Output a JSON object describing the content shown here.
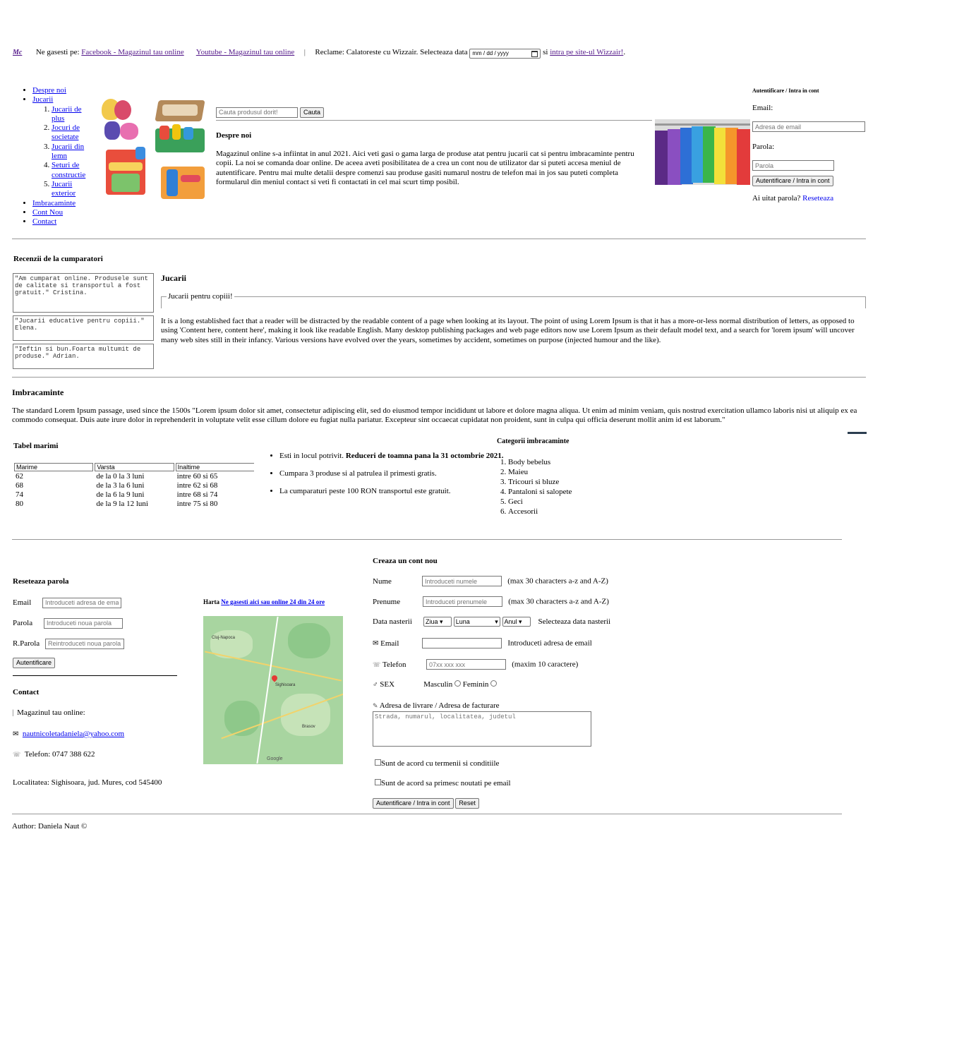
{
  "topbar": {
    "logo": "Mc",
    "find_us": "Ne gasesti pe:",
    "facebook_link": "Facebook - Magazinul tau online",
    "youtube_link": "Youtube - Magazinul tau online",
    "separator": "|",
    "ad_text": "Reclame: Calatoreste cu Wizzair. Selecteaza data",
    "date_placeholder": "mm / dd / yyyy",
    "and_text": "si",
    "wizzair_link": "intra pe site-ul Wizzair!",
    "end": "."
  },
  "nav": {
    "items": [
      "Despre noi",
      "Jucarii",
      "Imbracaminte",
      "Cont Nou",
      "Contact"
    ],
    "subitems": [
      "Jucarii de plus",
      "Jocuri de societate",
      "Jucarii din lemn",
      "Seturi de constructie",
      "Jucarii exterior"
    ]
  },
  "search": {
    "placeholder": "Cauta produsul dorit!",
    "button": "Cauta"
  },
  "about": {
    "title": "Despre noi",
    "text": "Magazinul online s-a infiintat in anul 2021. Aici veti gasi o gama larga de produse atat pentru jucarii cat si pentru imbracaminte pentru copii. La noi se comanda doar online. De aceea aveti posibilitatea de a crea un cont nou de utilizator dar si puteti accesa meniul de autentificare. Pentru mai multe detalii despre comenzi sau produse gasiti numarul nostru de telefon mai in jos sau puteti completa formularul din meniul contact si veti fi contactati in cel mai scurt timp posibil."
  },
  "login": {
    "title": "Autentificare / Intra in cont",
    "email_label": "Email:",
    "email_placeholder": "Adresa de email",
    "password_label": "Parola:",
    "password_placeholder": "Parola",
    "button": "Autentificare / Intra in cont",
    "forgot": "Ai uitat parola?",
    "reset_link": "Reseteaza"
  },
  "reviews": {
    "title": "Recenzii de la cumparatori",
    "items": [
      "\"Am cumparat online. Produsele sunt de calitate si transportul a fost gratuit.\" Cristina.",
      "\"Jucarii educative pentru copiii.\" Elena.",
      "\"Ieftin si bun.Foarta multumit de produse.\" Adrian."
    ]
  },
  "toys": {
    "title": "Jucarii",
    "legend": "Jucarii pentru copiii!",
    "text": "It is a long established fact that a reader will be distracted by the readable content of a page when looking at its layout. The point of using Lorem Ipsum is that it has a more-or-less normal distribution of letters, as opposed to using 'Content here, content here', making it look like readable English. Many desktop publishing packages and web page editors now use Lorem Ipsum as their default model text, and a search for 'lorem ipsum' will uncover many web sites still in their infancy. Various versions have evolved over the years, sometimes by accident, sometimes on purpose (injected humour and the like)."
  },
  "clothes": {
    "title": "Imbracaminte",
    "text": "The standard Lorem Ipsum passage, used since the 1500s \"Lorem ipsum dolor sit amet, consectetur adipiscing elit, sed do eiusmod tempor incididunt ut labore et dolore magna aliqua. Ut enim ad minim veniam, quis nostrud exercitation ullamco laboris nisi ut aliquip ex ea commodo consequat. Duis aute irure dolor in reprehenderit in voluptate velit esse cillum dolore eu fugiat nulla pariatur. Excepteur sint occaecat cupidatat non proident, sunt in culpa qui officia deserunt mollit anim id est laborum.\""
  },
  "size_table": {
    "title": "Tabel marimi",
    "headers": [
      "Marime",
      "Varsta",
      "Inaltime"
    ],
    "rows": [
      [
        "62",
        "de la 0 la 3 luni",
        "intre 60 si 65"
      ],
      [
        "68",
        "de la 3 la 6 luni",
        "intre 62 si 68"
      ],
      [
        "74",
        "de la 6 la 9 luni",
        "intre 68 si 74"
      ],
      [
        "80",
        "de la 9 la 12 luni",
        "intre 75 si 80"
      ]
    ]
  },
  "promo": {
    "item1_prefix": "Esti in locul potrivit.",
    "item1_bold": "Reduceri de toamna pana la 31 octombrie 2021.",
    "item2": "Cumpara 3 produse si al patrulea il primesti gratis.",
    "item3": "La cumparaturi peste 100 RON transportul este gratuit."
  },
  "categories": {
    "title": "Categorii imbracaminte",
    "items": [
      "Body bebelus",
      "Maieu",
      "Tricouri si bluze",
      "Pantaloni si salopete",
      "Geci",
      "Accesorii"
    ]
  },
  "reset": {
    "title": "Reseteaza parola",
    "email_label": "Email",
    "email_placeholder": "Introduceti adresa de email",
    "password_label": "Parola",
    "password_placeholder": "Introduceti noua parola",
    "repeat_label": "R.Parola",
    "repeat_placeholder": "Reintroduceti noua parola",
    "button": "Autentificare"
  },
  "contact": {
    "title": "Contact",
    "shop": "Magazinul tau online:",
    "email": "nautnicoletadaniela@yahoo.com",
    "phone": "Telefon: 0747 388 622",
    "address": "Localitatea: Sighisoara, jud. Mures, cod 545400"
  },
  "map": {
    "label": "Harta",
    "link": "Ne gasesti aici sau online 24 din 24 ore",
    "city_top": "Cluj-Napoca",
    "city_center": "Sighisoara",
    "city_bottom": "Brasov",
    "google": "Google"
  },
  "signup": {
    "title": "Creaza un cont nou",
    "name_label": "Nume",
    "name_placeholder": "Introduceti numele",
    "name_hint": "(max 30 characters a-z and A-Z)",
    "surname_label": "Prenume",
    "surname_placeholder": "Introduceti prenumele",
    "surname_hint": "(max 30 characters a-z and A-Z)",
    "birth_label": "Data nasterii",
    "day": "Ziua",
    "month": "Luna",
    "year": "Anul",
    "birth_hint": "Selecteaza data nasterii",
    "email_label": "Email",
    "email_hint": "Introduceti adresa de email",
    "phone_label": "Telefon",
    "phone_placeholder": "07xx xxx xxx",
    "phone_hint": "(maxim 10 caractere)",
    "sex_label": "SEX",
    "male": "Masculin",
    "female": "Feminin",
    "address_label": "Adresa de livrare / Adresa de facturare",
    "address_placeholder": "Strada, numarul, localitatea, judetul",
    "terms": "Sunt de acord cu termenii si conditiile",
    "news": "Sunt de acord sa primesc noutati pe email",
    "submit": "Autentificare / Intra in cont",
    "reset": "Reset"
  },
  "footer": {
    "author": "Author: Daniela Naut ©"
  },
  "colors": {
    "link": "#0000ee",
    "visited": "#551a8b",
    "rule": "#999999"
  }
}
